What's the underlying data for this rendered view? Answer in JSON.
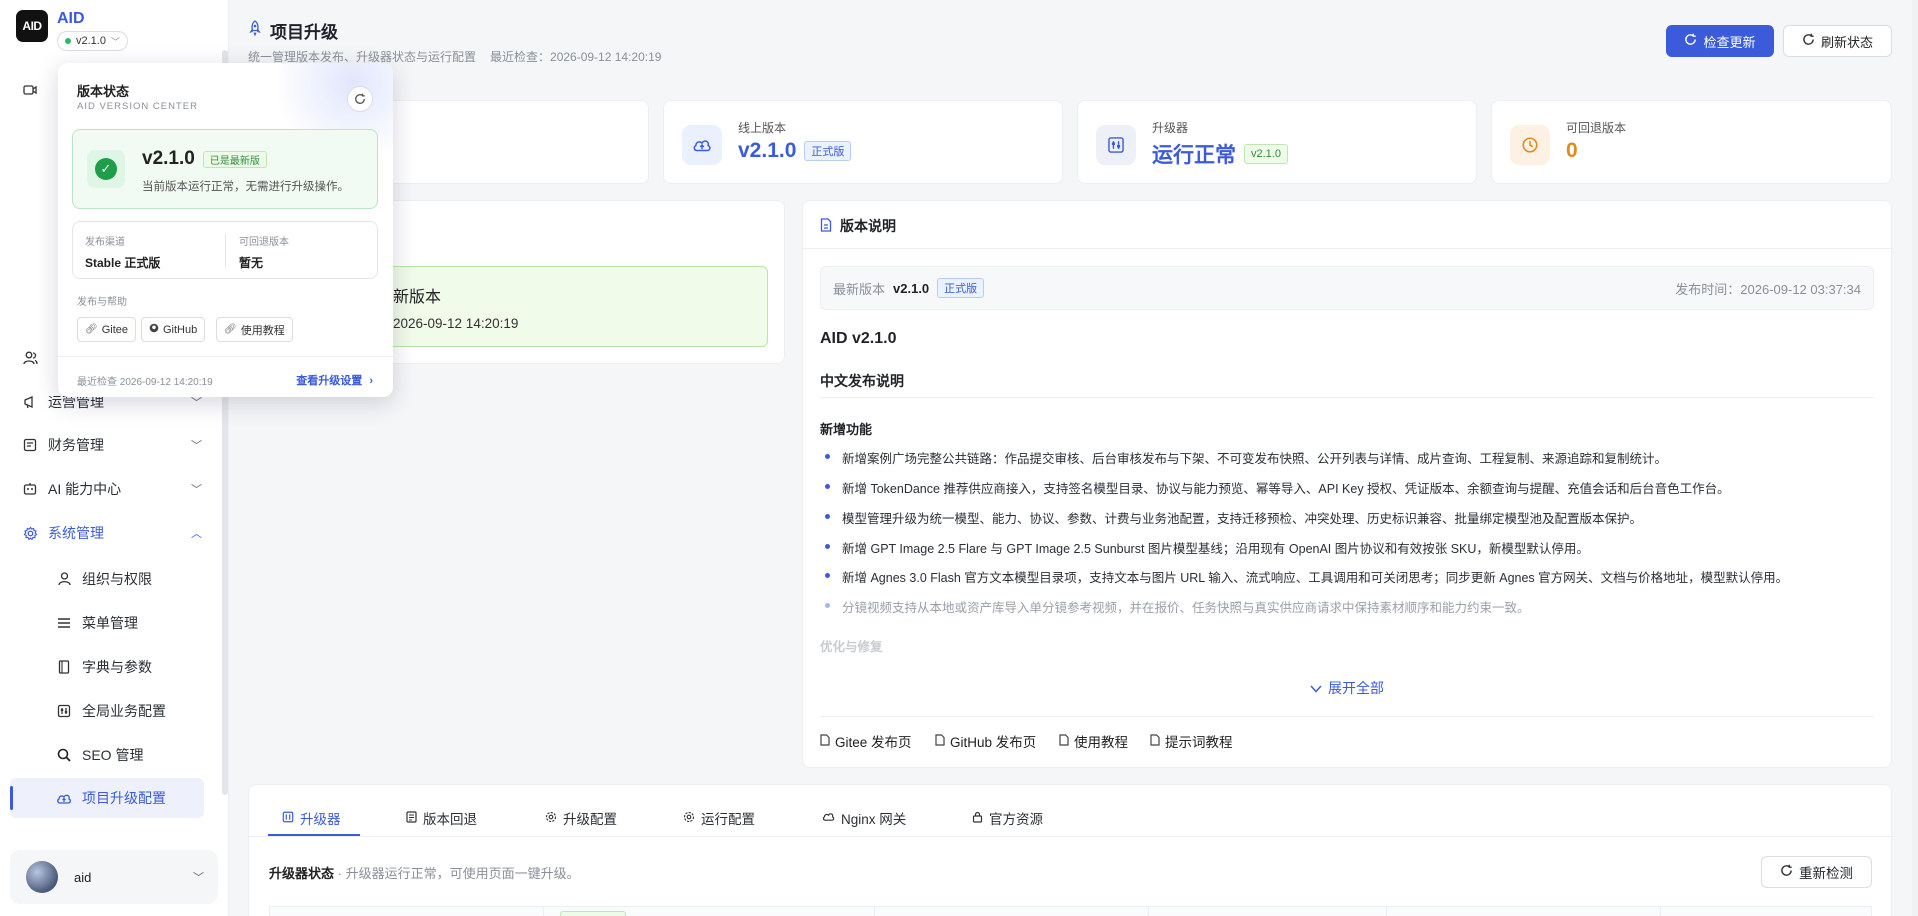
{
  "brand": {
    "logo_text": "AID",
    "name": "AID",
    "version": "v2.1.0"
  },
  "sidebar": {
    "items": [
      {
        "label": "运营管理"
      },
      {
        "label": "财务管理"
      },
      {
        "label": "AI 能力中心"
      },
      {
        "label": "系统管理"
      }
    ],
    "sub_items": [
      {
        "label": "组织与权限"
      },
      {
        "label": "菜单管理"
      },
      {
        "label": "字典与参数"
      },
      {
        "label": "全局业务配置"
      },
      {
        "label": "SEO 管理"
      },
      {
        "label": "项目升级配置"
      }
    ],
    "user": {
      "name": "aid"
    }
  },
  "header": {
    "title": "项目升级",
    "subtitle": "统一管理版本发布、升级器状态与运行配置",
    "last_check": "最近检查：2026-09-12 14:20:19",
    "check_update": "检查更新",
    "refresh_status": "刷新状态"
  },
  "stats": {
    "online": {
      "label": "线上版本",
      "value": "v2.1.0",
      "tag": "正式版"
    },
    "upgrader": {
      "label": "升级器",
      "value": "运行正常",
      "tag": "v2.1.0"
    },
    "rollback": {
      "label": "可回退版本",
      "value": "0"
    }
  },
  "left_card": {
    "line1": "新版本",
    "line2": "2026-09-12 14:20:19"
  },
  "notes": {
    "title": "版本说明",
    "latest_label": "最新版本",
    "latest_version": "v2.1.0",
    "latest_tag": "正式版",
    "published": "发布时间：2026-09-12 03:37:34",
    "h1": "AID v2.1.0",
    "h2": "中文发布说明",
    "h3": "新增功能",
    "items": [
      "新增案例广场完整公共链路：作品提交审核、后台审核发布与下架、不可变发布快照、公开列表与详情、成片查询、工程复制、来源追踪和复制统计。",
      "新增 TokenDance 推荐供应商接入，支持签名模型目录、协议与能力预览、幂等导入、API Key 授权、凭证版本、余额查询与提醒、充值会话和后台音色工作台。",
      "模型管理升级为统一模型、能力、协议、参数、计费与业务池配置，支持迁移预检、冲突处理、历史标识兼容、批量绑定模型池及配置版本保护。",
      "新增 GPT Image 2.5 Flare 与 GPT Image 2.5 Sunburst 图片模型基线；沿用现有 OpenAI 图片协议和有效按张 SKU，新模型默认停用。",
      "新增 Agnes 3.0 Flash 官方文本模型目录项，支持文本与图片 URL 输入、流式响应、工具调用和可关闭思考；同步更新 Agnes 官方网关、文档与价格地址，模型默认停用。",
      "分镜视频支持从本地或资产库导入单分镜参考视频，并在报价、任务快照与真实供应商请求中保持素材顺序和能力约束一致。"
    ],
    "h3_next": "优化与修复",
    "expand": "展开全部",
    "links": [
      "Gitee 发布页",
      "GitHub 发布页",
      "使用教程",
      "提示词教程"
    ]
  },
  "tabs": [
    "升级器",
    "版本回退",
    "升级配置",
    "运行配置",
    "Nginx 网关",
    "官方资源"
  ],
  "upgrader": {
    "state_label": "升级器状态",
    "state_desc": "· 升级器运行正常，可使用页面一键升级。",
    "recheck": "重新检测"
  },
  "popover": {
    "title": "版本状态",
    "subtitle": "AID VERSION CENTER",
    "version": "v2.1.0",
    "latest_tag": "已是最新版",
    "desc": "当前版本运行正常，无需进行升级操作。",
    "channel_label": "发布渠道",
    "channel_value": "Stable 正式版",
    "rollback_label": "可回退版本",
    "rollback_value": "暂无",
    "help_label": "发布与帮助",
    "links": [
      "Gitee",
      "GitHub",
      "使用教程"
    ],
    "last_check": "最近检查 2026-09-12 14:20:19",
    "settings_link": "查看升级设置"
  },
  "colors": {
    "accent": "#3b5bdb",
    "success": "#1f9e4a",
    "warning": "#e08a1e"
  }
}
